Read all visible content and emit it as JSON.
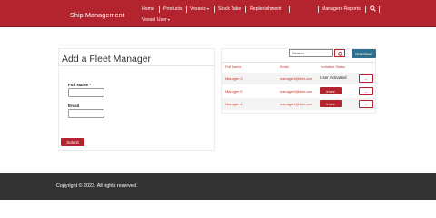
{
  "navbar": {
    "brand": "Ship Management",
    "items": [
      {
        "label": "Home"
      },
      {
        "label": "Products"
      },
      {
        "label": "Vessels",
        "caret": "▾"
      },
      {
        "label": "Stock Take"
      },
      {
        "label": "Replenishment"
      },
      {
        "label": "Managers Reports"
      }
    ],
    "vessel_user": {
      "label": "Vessel User",
      "caret": "▾"
    },
    "search_icon": "search-icon"
  },
  "form": {
    "title": "Add a Fleet Manager",
    "full_name_label": "Full Name",
    "required_mark": "*",
    "full_name_value": "",
    "email_label": "Email",
    "email_value": "",
    "submit_label": "Submit"
  },
  "managers": {
    "search_placeholder": "Search",
    "search_icon": "search-icon",
    "download_label": "Download",
    "columns": [
      "Full Name",
      "Email",
      "Invitation Status"
    ],
    "rows": [
      {
        "name": "Manager 3",
        "email": "manager3@test.com",
        "status": "User Activated",
        "invite_label": "",
        "action_icon": "chevron-down-icon"
      },
      {
        "name": "Manager 5",
        "email": "manager5@test.com",
        "status": "",
        "invite_label": "Invite",
        "action_icon": "chevron-down-icon"
      },
      {
        "name": "Manager 4",
        "email": "manager4@test.com",
        "status": "",
        "invite_label": "Invite",
        "action_icon": "chevron-down-icon"
      }
    ]
  },
  "footer": {
    "copyright": "Copyright © 2023. All rights reserved."
  },
  "colors": {
    "brand": "#b3242f",
    "download": "#2f6f8f",
    "footer": "#333333"
  }
}
